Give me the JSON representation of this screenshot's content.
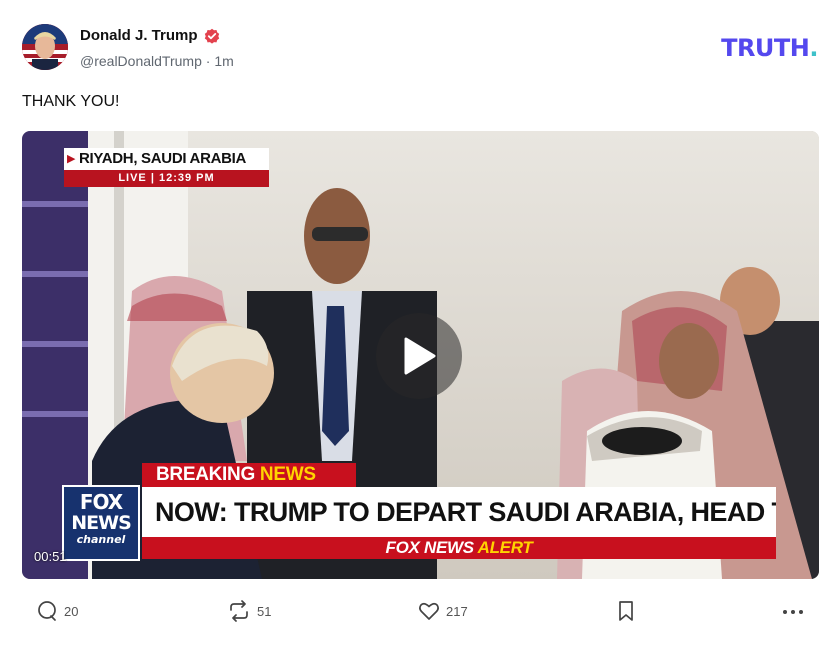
{
  "author": {
    "display_name": "Donald J. Trump",
    "handle": "@realDonaldTrump",
    "time_ago": "1m"
  },
  "brand": {
    "name": "TRUTH",
    "dot": "."
  },
  "post": {
    "text": "THANK YOU!"
  },
  "video": {
    "timestamp": "00:51",
    "location": "RIYADH, SAUDI ARABIA",
    "live_label": "LIVE",
    "live_time": "12:39 PM",
    "breaking_1": "BREAKING",
    "breaking_2": "NEWS",
    "headline": "NOW: TRUMP TO DEPART SAUDI ARABIA, HEAD TO QATAR",
    "alert_1": "FOX NEWS",
    "alert_2": "ALERT",
    "logo_line1": "FOX",
    "logo_line2": "NEWS",
    "logo_line3": "channel"
  },
  "actions": {
    "replies": "20",
    "retruths": "51",
    "likes": "217"
  },
  "colors": {
    "brand": "#5448ee",
    "brand_dot": "#3ec1c9",
    "verified": "#e3424e",
    "fox_red": "#c8101e",
    "fox_yellow": "#ffd400",
    "fox_blue": "#17326e"
  },
  "icons": [
    "verified-badge-icon",
    "play-icon",
    "reply-icon",
    "retruth-icon",
    "like-icon",
    "bookmark-icon",
    "more-icon"
  ]
}
